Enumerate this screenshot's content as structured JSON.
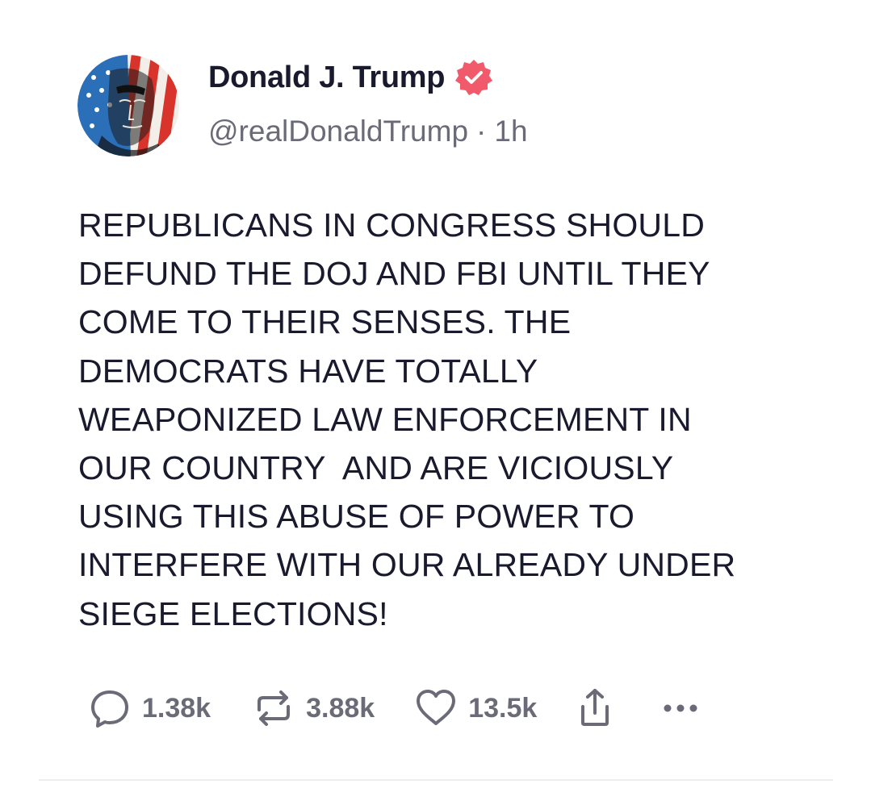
{
  "post": {
    "author": {
      "display_name": "Donald J. Trump",
      "handle": "@realDonaldTrump",
      "separator": "·",
      "time_ago": "1h",
      "verified": true,
      "verified_badge_color": "#f05a6b"
    },
    "text": "REPUBLICANS IN CONGRESS SHOULD\nDEFUND THE DOJ AND FBI UNTIL THEY\nCOME TO THEIR SENSES. THE\nDEMOCRATS HAVE TOTALLY\nWEAPONIZED LAW ENFORCEMENT IN\nOUR COUNTRY  AND ARE VICIOUSLY\nUSING THIS ABUSE OF POWER TO\nINTERFERE WITH OUR ALREADY UNDER\nSIEGE ELECTIONS!",
    "actions": {
      "reply": {
        "icon": "reply-icon",
        "count": "1.38k"
      },
      "repost": {
        "icon": "repost-icon",
        "count": "3.88k"
      },
      "like": {
        "icon": "heart-icon",
        "count": "13.5k"
      },
      "share": {
        "icon": "share-icon"
      },
      "more": {
        "icon": "more-icon"
      }
    }
  },
  "colors": {
    "text_primary": "#1a1a2e",
    "text_secondary": "#6b6b78",
    "badge": "#f05a6b"
  }
}
